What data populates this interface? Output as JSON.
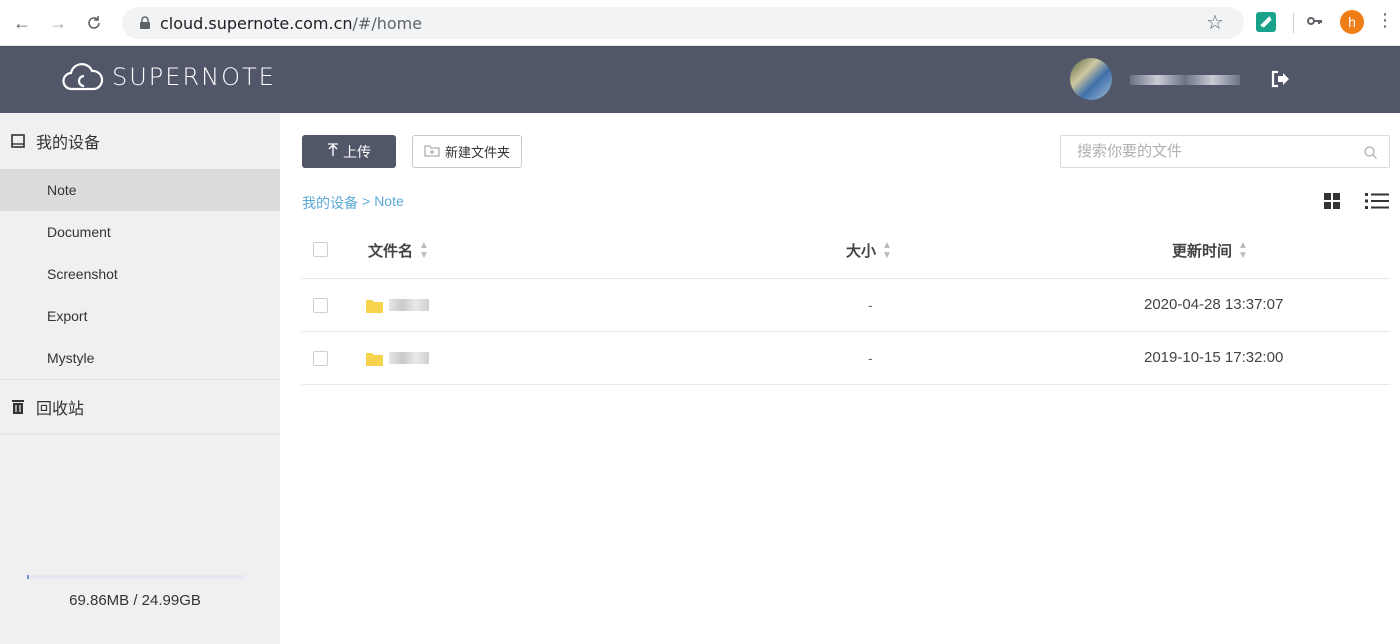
{
  "browser": {
    "url_host": "cloud.supernote.com.cn",
    "url_path": "/#/home",
    "profile_initial": "h"
  },
  "header": {
    "logo_text": "SUPERNOTE"
  },
  "sidebar": {
    "devices_label": "我的设备",
    "items": [
      {
        "label": "Note",
        "active": true
      },
      {
        "label": "Document",
        "active": false
      },
      {
        "label": "Screenshot",
        "active": false
      },
      {
        "label": "Export",
        "active": false
      },
      {
        "label": "Mystyle",
        "active": false
      }
    ],
    "trash_label": "回收站",
    "storage_text": "69.86MB / 24.99GB"
  },
  "toolbar": {
    "upload_label": "上传",
    "new_folder_label": "新建文件夹",
    "search_placeholder": "搜索你要的文件"
  },
  "breadcrumb": {
    "root": "我的设备",
    "separator": ">",
    "current": "Note"
  },
  "table": {
    "headers": {
      "name": "文件名",
      "size": "大小",
      "time": "更新时间"
    },
    "rows": [
      {
        "size": "-",
        "time": "2020-04-28 13:37:07"
      },
      {
        "size": "-",
        "time": "2019-10-15 17:32:00"
      }
    ]
  },
  "colors": {
    "header_bg": "#515768",
    "sidebar_bg": "#f0f0f0",
    "link": "#5aa9d8",
    "folder": "#f7d34d"
  }
}
